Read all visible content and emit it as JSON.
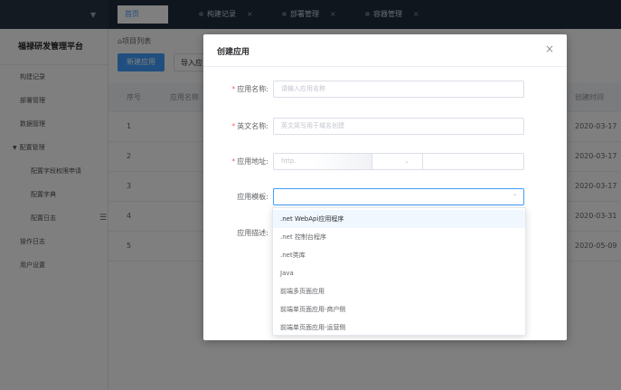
{
  "tabs": [
    {
      "label": "首页",
      "active": true,
      "closable": false
    },
    {
      "label": "构建记录",
      "active": false,
      "closable": true
    },
    {
      "label": "部署管理",
      "active": false,
      "closable": true
    },
    {
      "label": "容器管理",
      "active": false,
      "closable": true
    }
  ],
  "tab_close_glyph": "×",
  "sidebar": {
    "brand": "福禄研发管理平台",
    "items": [
      {
        "label": "构建记录",
        "type": "item"
      },
      {
        "label": "部署管理",
        "type": "item"
      },
      {
        "label": "数据管理",
        "type": "item"
      },
      {
        "label": "配置管理",
        "type": "group"
      },
      {
        "label": "配置字段权限申请",
        "type": "sub"
      },
      {
        "label": "配置字典",
        "type": "sub"
      },
      {
        "label": "配置日志",
        "type": "sub"
      },
      {
        "label": "操作日志",
        "type": "item"
      },
      {
        "label": "用户设置",
        "type": "item"
      }
    ]
  },
  "main": {
    "breadcrumb": "项目列表",
    "new_button": "新建应用",
    "import_button": "导入应",
    "table": {
      "headers": [
        "序号",
        "应用名称",
        "创建时间"
      ],
      "rows": [
        {
          "index": "1",
          "created": "2020-03-17"
        },
        {
          "index": "2",
          "created": "2020-03-17"
        },
        {
          "index": "3",
          "created": "2020-03-17"
        },
        {
          "index": "4",
          "created": "2020-03-31"
        },
        {
          "index": "5",
          "created": "2020-05-09"
        }
      ]
    }
  },
  "dialog": {
    "title": "创建应用",
    "close_glyph": "×",
    "fields": {
      "app_name": {
        "label": "应用名称:",
        "required": true,
        "placeholder": "请输入应用名称"
      },
      "english_name": {
        "label": "英文名称:",
        "required": true,
        "placeholder": "英文简写用于域名创建"
      },
      "app_address": {
        "label": "应用地址:",
        "required": true,
        "protocol_placeholder": "http.",
        "chevron": "⌄"
      },
      "template": {
        "label": "应用模板:",
        "required": false,
        "value": "",
        "chevron": "⌃"
      },
      "description": {
        "label": "应用描述:",
        "required": false
      }
    },
    "required_mark": "*"
  },
  "template_options": [
    ".net WebApi应用程序",
    ".net 控制台程序",
    ".net类库",
    "Java",
    "前端多页面应用",
    "前端单页面应用-商户侧",
    "前端单页面应用-运营侧"
  ],
  "colors": {
    "primary": "#409eff",
    "topbar": "#1f2d3d",
    "required": "#f56c6c"
  }
}
